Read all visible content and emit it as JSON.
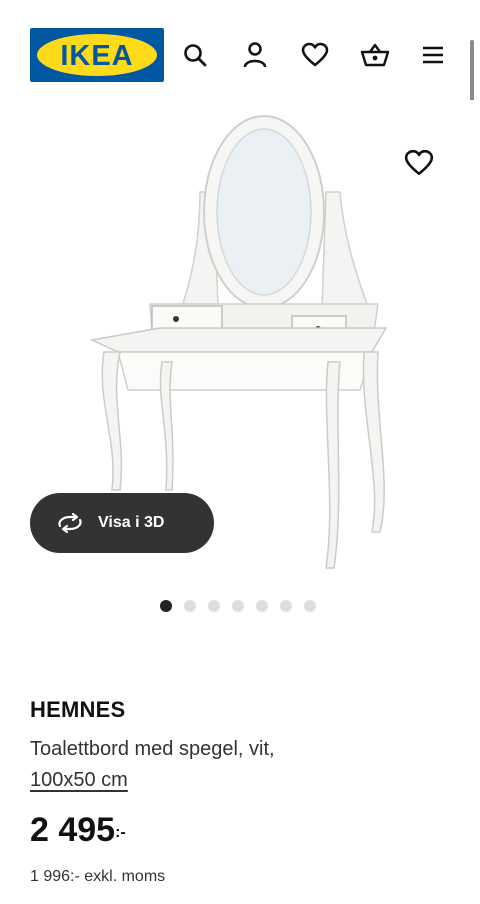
{
  "header": {
    "logo_text": "IKEA",
    "icons": [
      "search-icon",
      "user-icon",
      "heart-icon",
      "basket-icon",
      "menu-icon"
    ]
  },
  "gallery": {
    "view_3d_label": "Visa i 3D",
    "dots_total": 7,
    "active_dot": 1
  },
  "product": {
    "brand": "HEMNES",
    "description": "Toalettbord med spegel, vit,",
    "size": "100x50 cm",
    "price_main": "2 495",
    "price_suffix": ":-",
    "price_excl": "1 996:- exkl. moms"
  },
  "colors": {
    "ikea_blue": "#0058a3",
    "ikea_yellow": "#ffda1a",
    "button_dark": "#333333"
  }
}
